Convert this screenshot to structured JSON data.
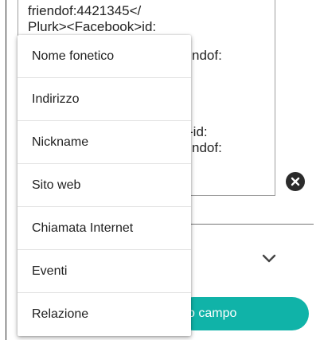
{
  "textarea": {
    "lines": [
      "friendof:4421345</",
      "Plurk><Facebook>id:",
      "ndof:",
      "-id:",
      "ndof:"
    ]
  },
  "clear_button": {
    "icon": "close-icon"
  },
  "menu": {
    "items": [
      "Nome fonetico",
      "Indirizzo",
      "Nickname",
      "Sito web",
      "Chiamata Internet",
      "Eventi",
      "Relazione"
    ]
  },
  "add_field_button": {
    "label": "o campo"
  },
  "colors": {
    "accent": "#10b3a8"
  }
}
